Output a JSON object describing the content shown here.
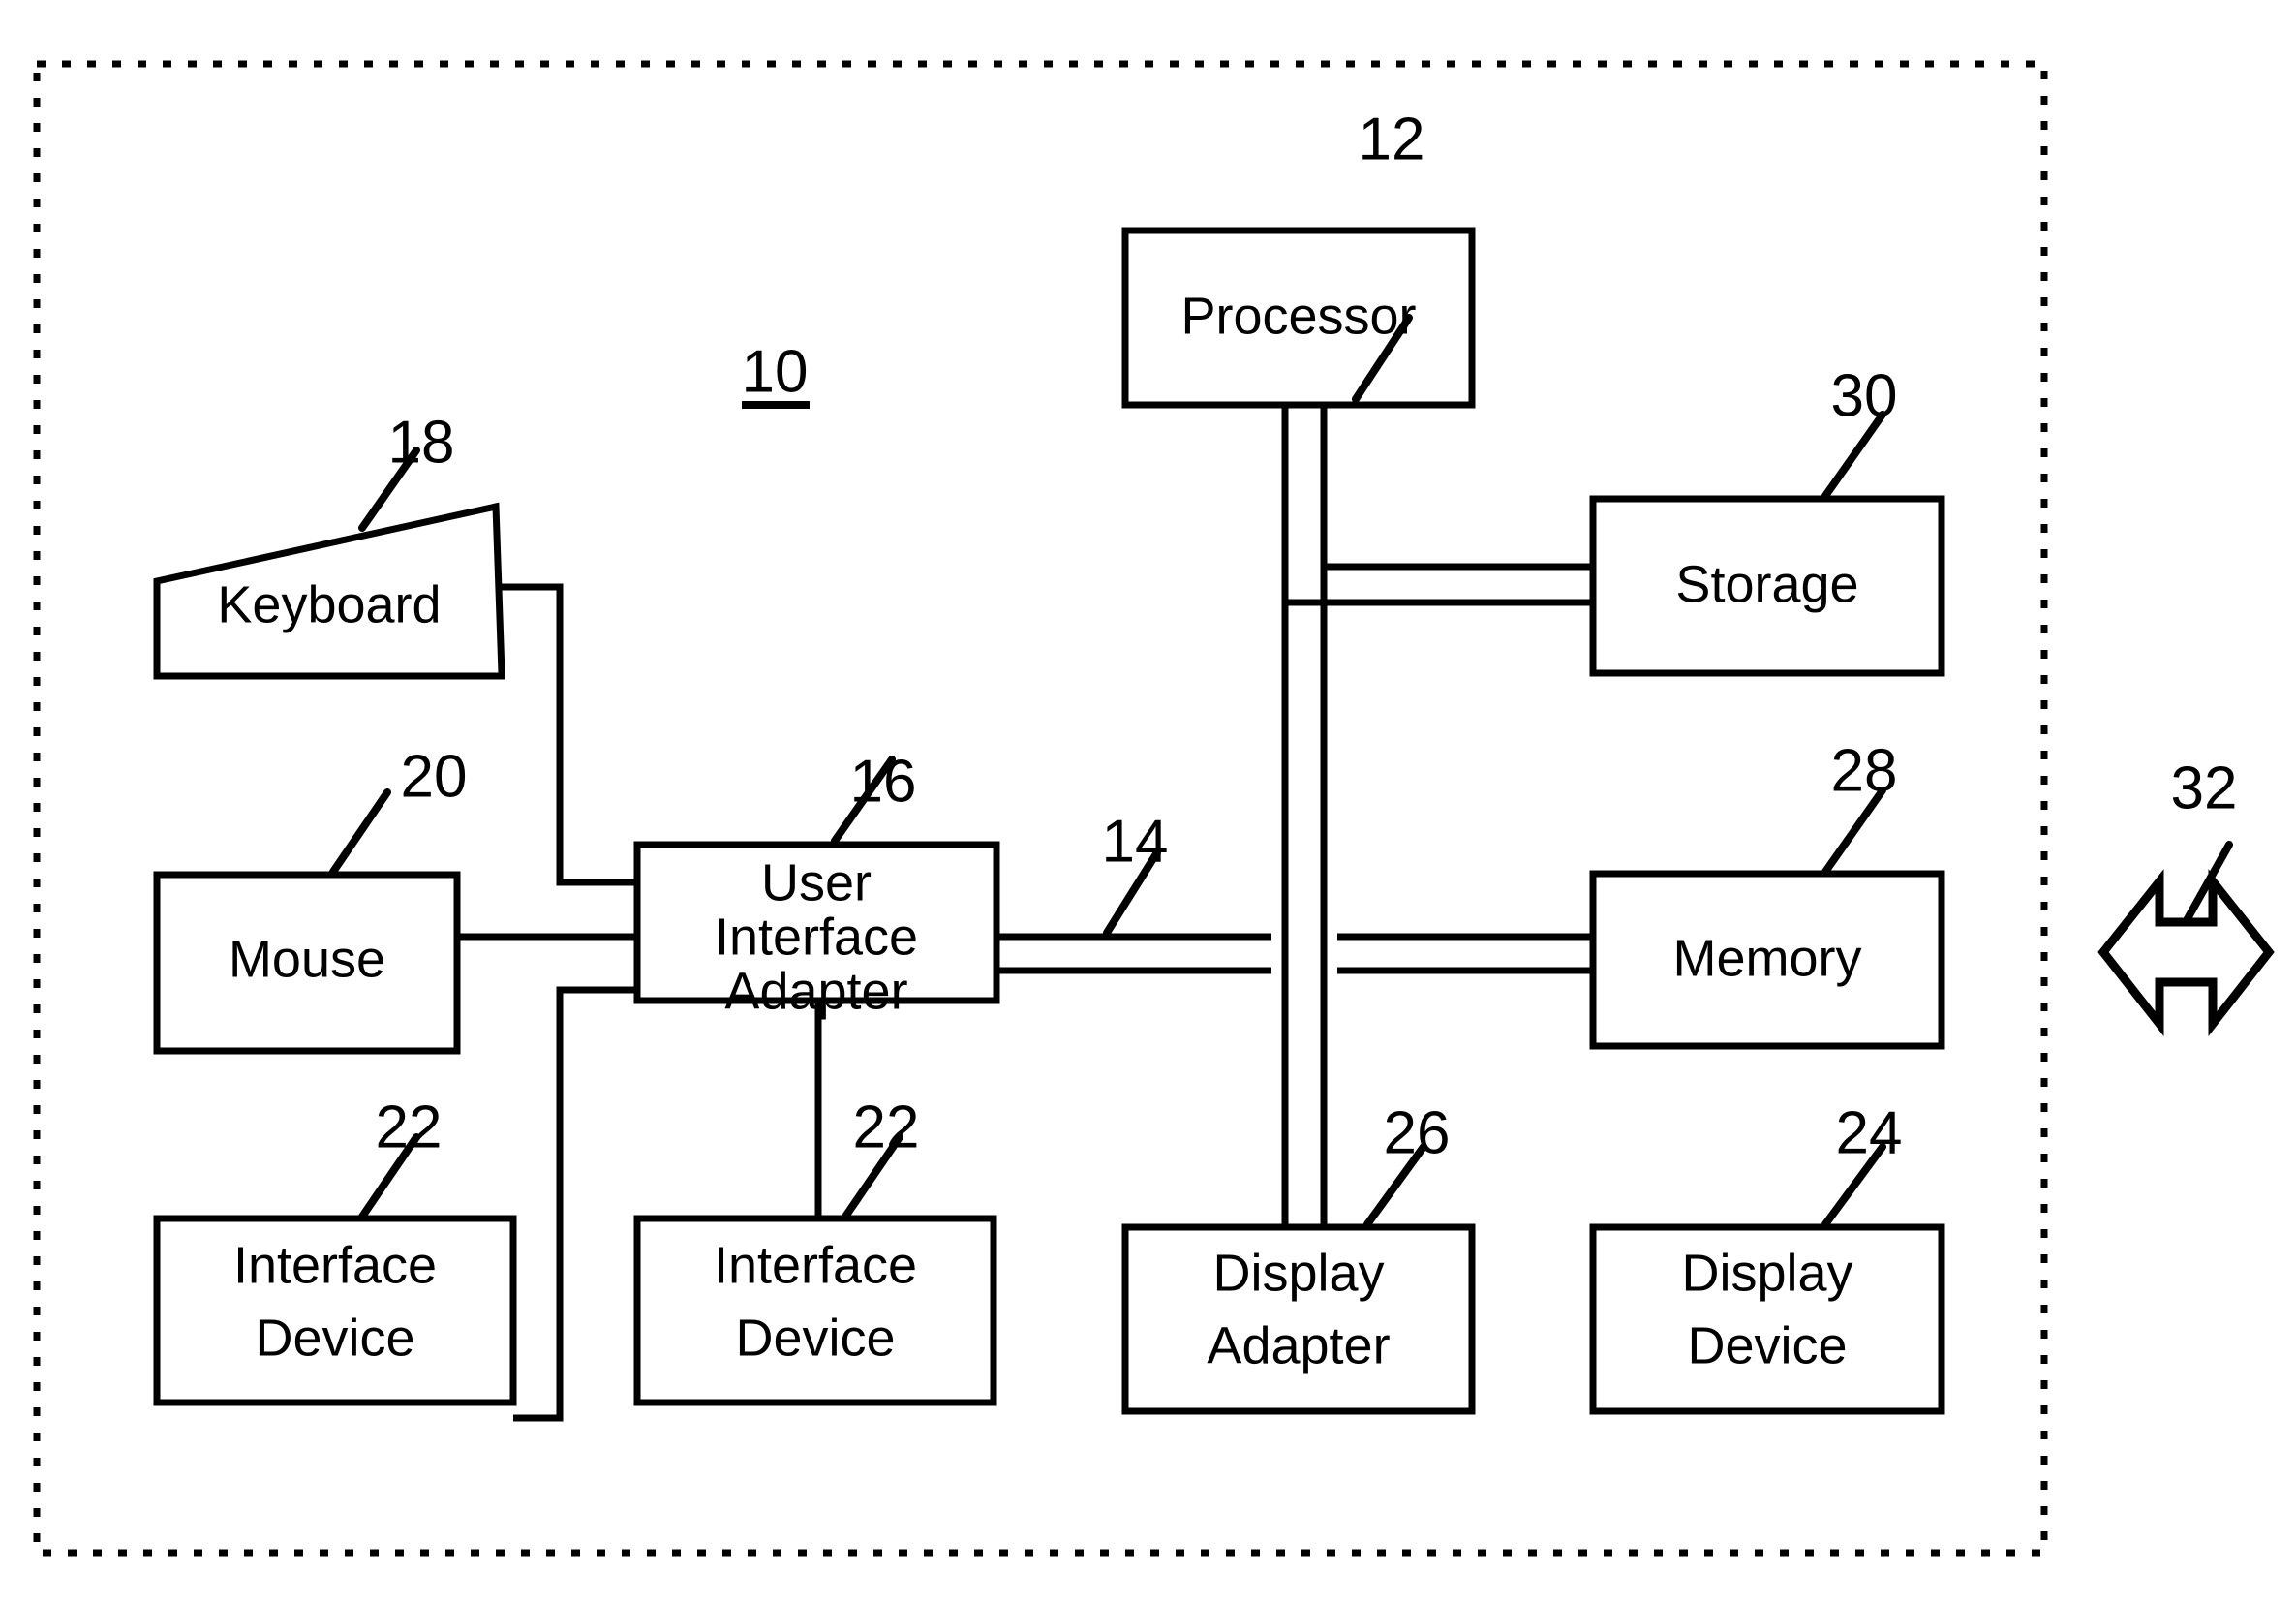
{
  "figure": {
    "system_ref": "10",
    "boundary_style": "dashed-enclosure"
  },
  "blocks": [
    {
      "id": "processor",
      "label": "Processor",
      "label_line2": "",
      "ref": "12",
      "shape": "rect"
    },
    {
      "id": "storage",
      "label": "Storage",
      "label_line2": "",
      "ref": "30",
      "shape": "rect"
    },
    {
      "id": "memory",
      "label": "Memory",
      "label_line2": "",
      "ref": "28",
      "shape": "rect"
    },
    {
      "id": "ui-adapter",
      "label": "User",
      "label_line2": "Interface",
      "label_line3": "Adapter",
      "ref": "16",
      "shape": "rect"
    },
    {
      "id": "keyboard",
      "label": "Keyboard",
      "label_line2": "",
      "ref": "18",
      "shape": "trapezoid"
    },
    {
      "id": "mouse",
      "label": "Mouse",
      "label_line2": "",
      "ref": "20",
      "shape": "rect"
    },
    {
      "id": "interface-device-left",
      "label": "Interface",
      "label_line2": "Device",
      "ref": "22",
      "shape": "rect"
    },
    {
      "id": "interface-device-mid",
      "label": "Interface",
      "label_line2": "Device",
      "ref": "22",
      "shape": "rect"
    },
    {
      "id": "display-adapter",
      "label": "Display",
      "label_line2": "Adapter",
      "ref": "26",
      "shape": "rect"
    },
    {
      "id": "display-device",
      "label": "Display",
      "label_line2": "Device",
      "ref": "24",
      "shape": "rect"
    },
    {
      "id": "external-arrow",
      "label": "",
      "label_line2": "",
      "ref": "32",
      "shape": "double-arrow"
    }
  ],
  "bus": {
    "ref": "14",
    "name": "system-bus",
    "style": "double-line"
  },
  "refs": {
    "system": "10",
    "processor": "12",
    "bus": "14",
    "ui_adapter": "16",
    "keyboard": "18",
    "mouse": "20",
    "interface_device_left": "22",
    "interface_device_mid": "22",
    "display_device": "24",
    "display_adapter": "26",
    "memory": "28",
    "storage": "30",
    "external_arrow": "32"
  },
  "labels": {
    "processor": "Processor",
    "storage": "Storage",
    "memory": "Memory",
    "ui_adapter_l1": "User",
    "ui_adapter_l2": "Interface",
    "ui_adapter_l3": "Adapter",
    "keyboard": "Keyboard",
    "mouse": "Mouse",
    "interface_l1": "Interface",
    "interface_l2": "Device",
    "display_adapter_l1": "Display",
    "display_adapter_l2": "Adapter",
    "display_device_l1": "Display",
    "display_device_l2": "Device"
  },
  "colors": {
    "ink": "#000000",
    "paper": "#ffffff"
  }
}
